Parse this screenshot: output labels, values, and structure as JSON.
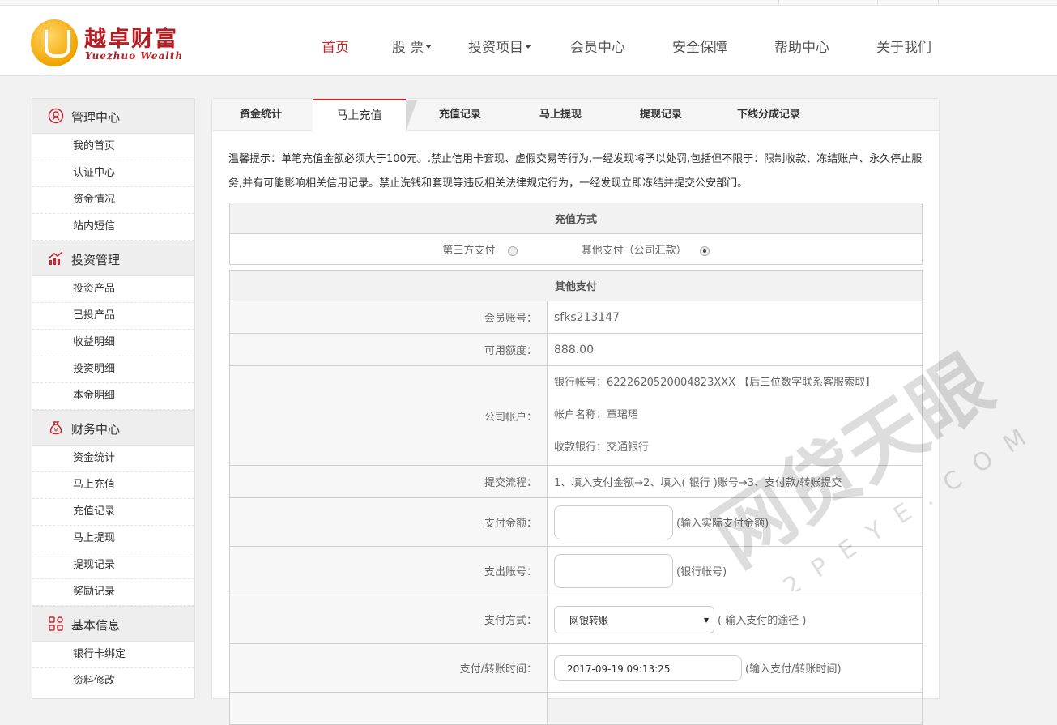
{
  "header": {
    "logo_cn": "越卓财富",
    "logo_en": "Yuezhuo Wealth",
    "nav": [
      {
        "label": "首页",
        "active": true,
        "dropdown": false
      },
      {
        "label": "股 票",
        "active": false,
        "dropdown": true
      },
      {
        "label": "投资项目",
        "active": false,
        "dropdown": true
      },
      {
        "label": "会员中心",
        "active": false,
        "dropdown": false
      },
      {
        "label": "安全保障",
        "active": false,
        "dropdown": false
      },
      {
        "label": "帮助中心",
        "active": false,
        "dropdown": false
      },
      {
        "label": "关于我们",
        "active": false,
        "dropdown": false
      }
    ]
  },
  "sidebar": {
    "sections": [
      {
        "title": "管理中心",
        "icon": "user-circle-icon",
        "items": [
          "我的首页",
          "认证中心",
          "资金情况",
          "站内短信"
        ]
      },
      {
        "title": "投资管理",
        "icon": "bar-chart-icon",
        "items": [
          "投资产品",
          "已投产品",
          "收益明细",
          "投资明细",
          "本金明细"
        ]
      },
      {
        "title": "财务中心",
        "icon": "money-bag-icon",
        "items": [
          "资金统计",
          "马上充值",
          "充值记录",
          "马上提现",
          "提现记录",
          "奖励记录"
        ]
      },
      {
        "title": "基本信息",
        "icon": "grid-icon",
        "items": [
          "银行卡绑定",
          "资料修改"
        ]
      }
    ]
  },
  "tabs": [
    {
      "label": "资金统计",
      "active": false
    },
    {
      "label": "马上充值",
      "active": true
    },
    {
      "label": "充值记录",
      "active": false
    },
    {
      "label": "马上提现",
      "active": false
    },
    {
      "label": "提现记录",
      "active": false
    },
    {
      "label": "下线分成记录",
      "active": false
    }
  ],
  "notice": "温馨提示：单笔充值金额必须大于100元。.禁止信用卡套现、虚假交易等行为,一经发现将予以处罚,包括但不限于：限制收款、冻结账户、永久停止服务,并有可能影响相关信用记录。禁止洗钱和套现等违反相关法律规定行为，一经发现立即冻结并提交公安部门。",
  "recharge_method": {
    "title": "充值方式",
    "option_third": "第三方支付",
    "option_other": "其他支付（公司汇款）",
    "selected": "other"
  },
  "other_payment": {
    "title": "其他支付",
    "member_label": "会员账号：",
    "member_value": "sfks213147",
    "quota_label": "可用额度：",
    "quota_value": "888.00",
    "company_label": "公司帐户：",
    "bank_account": "银行帐号：6222620520004823XXX 【后三位数字联系客服索取】",
    "account_name": "帐户名称：覃珺珺",
    "bank_name": "收款银行：交通银行",
    "process_label": "提交流程：",
    "process_value": "1、填入支付金额→2、填入( 银行 )账号→3、支付款/转账提交",
    "amount_label": "支付金额：",
    "amount_value": "",
    "amount_hint": "(输入实际支付金额)",
    "outaccount_label": "支出账号：",
    "outaccount_value": "",
    "outaccount_hint": "(银行帐号)",
    "method_label": "支付方式：",
    "method_value": "网银转账",
    "method_hint": "( 输入支付的途径 )",
    "time_label": "支付/转账时间：",
    "time_value": "2017-09-19 09:13:25",
    "time_hint": "(输入支付/转账时间)"
  },
  "watermark": {
    "main": "网贷天眼",
    "sub": "P2PEYE.COM"
  }
}
